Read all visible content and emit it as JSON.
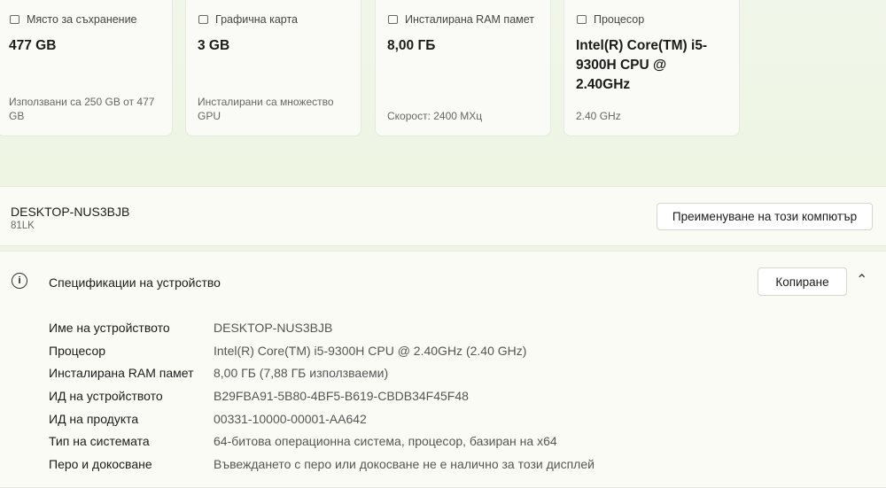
{
  "cards": [
    {
      "icon": "storage-icon",
      "title": "Място за съхранение",
      "value": "477 GB",
      "sub": "Използвани са 250 GB от 477 GB"
    },
    {
      "icon": "graphics-card-icon",
      "title": "Графична карта",
      "value": "3 GB",
      "sub": "Инсталирани са множество GPU"
    },
    {
      "icon": "ram-icon",
      "title": "Инсталирана RAM памет",
      "value": "8,00 ГБ",
      "sub": "Скорост: 2400 MXц"
    },
    {
      "icon": "processor-icon",
      "title": "Процесор",
      "value": "Intel(R) Core(TM) i5-9300H CPU @ 2.40GHz",
      "sub": "2.40 GHz"
    }
  ],
  "device": {
    "name": "DESKTOP-NUS3BJB",
    "model": "81LK",
    "rename_label": "Преименуване на този компютър"
  },
  "specs": {
    "title": "Спецификации на устройство",
    "copy_label": "Копиране",
    "rows": [
      {
        "k": "Име на устройството",
        "v": "DESKTOP-NUS3BJB"
      },
      {
        "k": "Процесор",
        "v": "Intel(R) Core(TM) i5-9300H CPU @ 2.40GHz (2.40 GHz)"
      },
      {
        "k": "Инсталирана RAM памет",
        "v": "8,00 ГБ (7,88 ГБ използваеми)"
      },
      {
        "k": "ИД на устройството",
        "v": "B29FBA91-5B80-4BF5-B619-CBDB34F45F48"
      },
      {
        "k": "ИД на продукта",
        "v": "00331-10000-00001-AA642"
      },
      {
        "k": "Тип на системата",
        "v": "64-битова операционна система, процесор, базиран на x64"
      },
      {
        "k": "Перо и докосване",
        "v": "Въвеждането с перо или докосване не е налично за този дисплей"
      }
    ]
  }
}
